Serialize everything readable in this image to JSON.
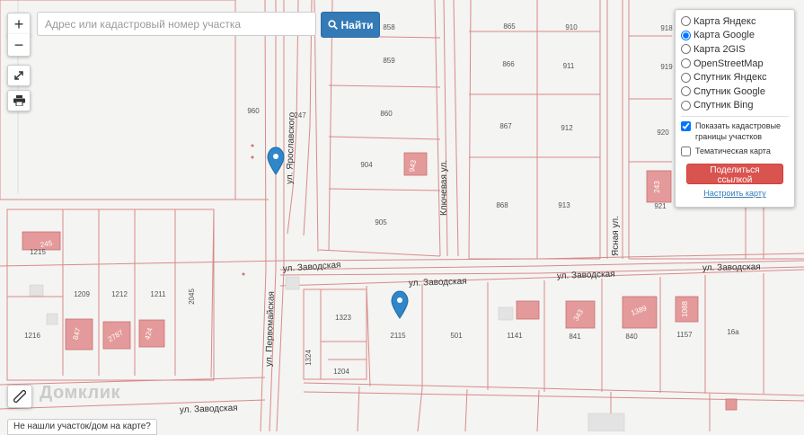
{
  "search": {
    "placeholder": "Адрес или кадастровый номер участка",
    "button_label": "Найти"
  },
  "zoom": {
    "in_label": "+",
    "out_label": "−"
  },
  "layers": {
    "options": [
      "Карта Яндекс",
      "Карта Google",
      "Карта 2GIS",
      "OpenStreetMap",
      "Спутник Яндекс",
      "Спутник Google",
      "Спутник Bing"
    ],
    "selected": "Карта Google",
    "show_boundaries_label": "Показать кадастровые границы участков",
    "show_boundaries_checked": true,
    "thematic_label": "Тематическая карта",
    "thematic_checked": false,
    "share_label": "Поделиться ссылкой",
    "setup_link": "Настроить карту"
  },
  "not_found_label": "Не нашли участок/дом на карте?",
  "watermark": "Домклик",
  "streets": {
    "zavodskaya": "ул. Заводская",
    "pervomayskaya": "ул. Первомайская",
    "yaroslavskogo": "ул. Ярославского",
    "klyuchevaya": "Ключевая ул.",
    "yasnaya": "Ясная ул."
  },
  "parcels": [
    "858",
    "859",
    "860",
    "904",
    "905",
    "865",
    "866",
    "867",
    "868",
    "910",
    "911",
    "912",
    "913",
    "918",
    "919",
    "920",
    "921",
    "960",
    "247",
    "1215",
    "1209",
    "1212",
    "1211",
    "2045",
    "1216",
    "1323",
    "1324",
    "1204",
    "2115",
    "501",
    "1141",
    "841",
    "840",
    "1157",
    "16a"
  ],
  "building_labels": [
    "943",
    "245",
    "847",
    "2787",
    "424",
    "343",
    "1389",
    "1088",
    "243"
  ],
  "colors": {
    "parcel_line": "#d88a8a",
    "building": "#e49a9a",
    "marker": "#2f86c9",
    "accent": "#337ab7",
    "share": "#d9534f"
  }
}
